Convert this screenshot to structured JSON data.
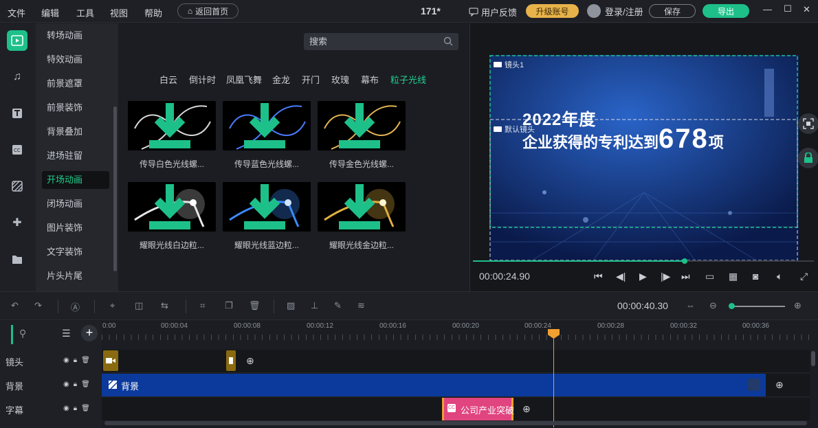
{
  "menu": [
    "文件",
    "编辑",
    "工具",
    "视图",
    "帮助"
  ],
  "home_button": "返回首页",
  "doc_title": "171*",
  "feedback": "用户反馈",
  "upgrade": "升级账号",
  "login": "登录/注册",
  "save": "保存",
  "export": "导出",
  "categories": [
    "转场动画",
    "特效动画",
    "前景遮罩",
    "前景装饰",
    "背景叠加",
    "进场驻留",
    "开场动画",
    "闭场动画",
    "图片装饰",
    "文字装饰",
    "片头片尾"
  ],
  "active_category": "开场动画",
  "search_placeholder": "搜索",
  "tags": [
    "白云",
    "倒计时",
    "凤凰飞舞",
    "金龙",
    "开门",
    "玫瑰",
    "幕布",
    "粒子光线"
  ],
  "active_tag": "粒子光线",
  "assets": [
    {
      "label": "传导白色光线螺...",
      "color": "#d8d8d8"
    },
    {
      "label": "传导蓝色光线螺...",
      "color": "#4a7cff"
    },
    {
      "label": "传导金色光线螺...",
      "color": "#e2b450"
    },
    {
      "label": "耀眼光线白边粒...",
      "color": "#e8e8e8"
    },
    {
      "label": "耀眼光线蓝边粒...",
      "color": "#3a8cff"
    },
    {
      "label": "耀眼光线金边粒...",
      "color": "#e0b040"
    }
  ],
  "preview": {
    "camera1": "镜头1",
    "default_camera": "默认镜头",
    "headline1": "2022年度",
    "headline2_prefix": "企业获得的专利达到",
    "headline2_number": "678",
    "headline2_suffix": "项",
    "timecode": "00:00:24.90",
    "progress": 0.62
  },
  "toolbar": {
    "duration": "00:00:40.30"
  },
  "ruler": [
    "0:00",
    "00:00:04",
    "00:00:08",
    "00:00:12",
    "00:00:16",
    "00:00:20",
    "00:00:24",
    "00:00:28",
    "00:00:32",
    "00:00:36"
  ],
  "tracks": [
    {
      "name": "镜头"
    },
    {
      "name": "背景",
      "clip_label": "背景"
    },
    {
      "name": "字幕",
      "clip_label": "公司产业突破"
    }
  ],
  "colors": {
    "accent": "#1ec08a",
    "upgrade": "#e7b24a",
    "playhead": "#f0a030",
    "background_clip": "#0b3a9c",
    "subtitle_clip": "#e0457f",
    "camera_clip": "#8a6a10"
  }
}
